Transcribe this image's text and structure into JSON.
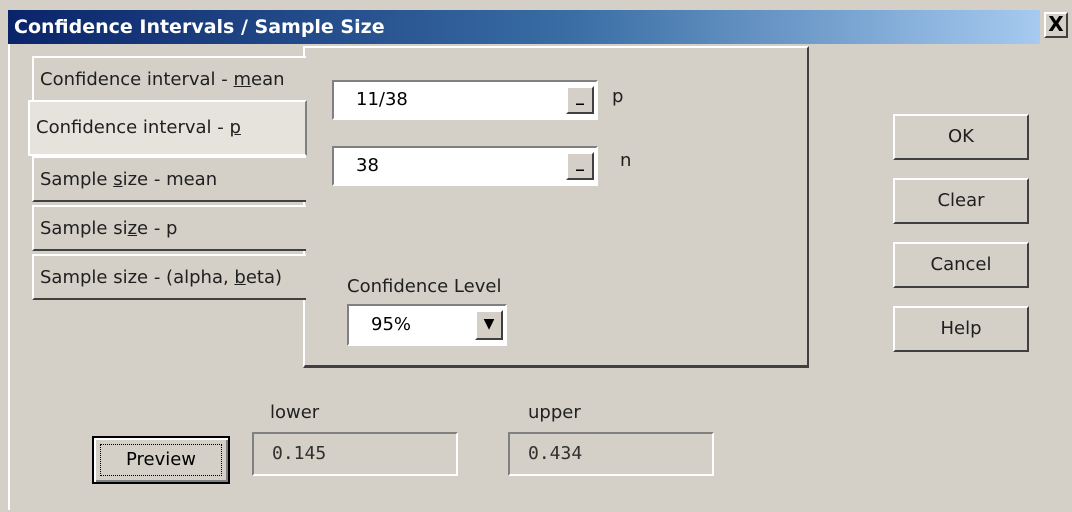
{
  "window": {
    "title": "Confidence Intervals / Sample Size",
    "close_glyph": "X"
  },
  "tabs": [
    {
      "pre": "Confidence interval - ",
      "ul": "m",
      "post": "ean"
    },
    {
      "pre": "Confidence interval - ",
      "ul": "p",
      "post": ""
    },
    {
      "pre": "Sample ",
      "ul": "s",
      "post": "ize - mean"
    },
    {
      "pre": "Sample si",
      "ul": "z",
      "post": "e - p"
    },
    {
      "pre": "Sample size - (alpha, ",
      "ul": "b",
      "post": "eta)"
    }
  ],
  "fields": {
    "p": {
      "value": "11/38",
      "label": "p",
      "btn": "_"
    },
    "n": {
      "value": "38",
      "label": "n",
      "btn": "_"
    }
  },
  "confidence": {
    "label": "Confidence Level",
    "value": "95%",
    "arrow": "▼"
  },
  "buttons": {
    "ok": "OK",
    "clear": "Clear",
    "cancel": "Cancel",
    "help": "Help",
    "preview": "Preview"
  },
  "results": {
    "lower_label": "lower",
    "lower_value": "0.145",
    "upper_label": "upper",
    "upper_value": "0.434"
  }
}
